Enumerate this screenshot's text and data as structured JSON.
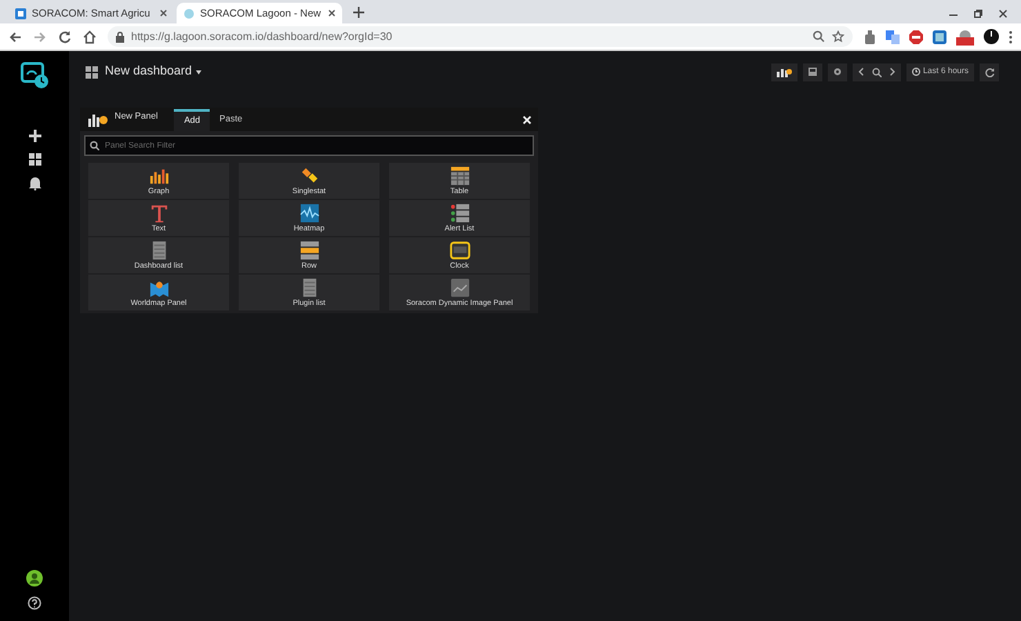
{
  "browser": {
    "tabs": [
      {
        "title": "SORACOM: Smart Agricu",
        "selected": false
      },
      {
        "title": "SORACOM Lagoon - New",
        "selected": true
      }
    ],
    "url": "https://g.lagoon.soracom.io/dashboard/new?orgId=30"
  },
  "dashboard": {
    "title": "New dashboard",
    "time_range": "Last 6 hours"
  },
  "add_panel": {
    "title": "New Panel",
    "tabs": [
      {
        "label": "Add",
        "selected": true
      },
      {
        "label": "Paste",
        "selected": false
      }
    ],
    "search": {
      "placeholder": "Panel Search Filter"
    },
    "panels": [
      {
        "label": "Graph",
        "kind": "graph"
      },
      {
        "label": "Singlestat",
        "kind": "singlestat"
      },
      {
        "label": "Table",
        "kind": "table"
      },
      {
        "label": "Text",
        "kind": "text"
      },
      {
        "label": "Heatmap",
        "kind": "heatmap"
      },
      {
        "label": "Alert List",
        "kind": "alertlist"
      },
      {
        "label": "Dashboard list",
        "kind": "list"
      },
      {
        "label": "Row",
        "kind": "row"
      },
      {
        "label": "Clock",
        "kind": "clock"
      },
      {
        "label": "Worldmap Panel",
        "kind": "worldmap"
      },
      {
        "label": "Plugin list",
        "kind": "list"
      },
      {
        "label": "Soracom Dynamic Image Panel",
        "kind": "image"
      }
    ]
  }
}
